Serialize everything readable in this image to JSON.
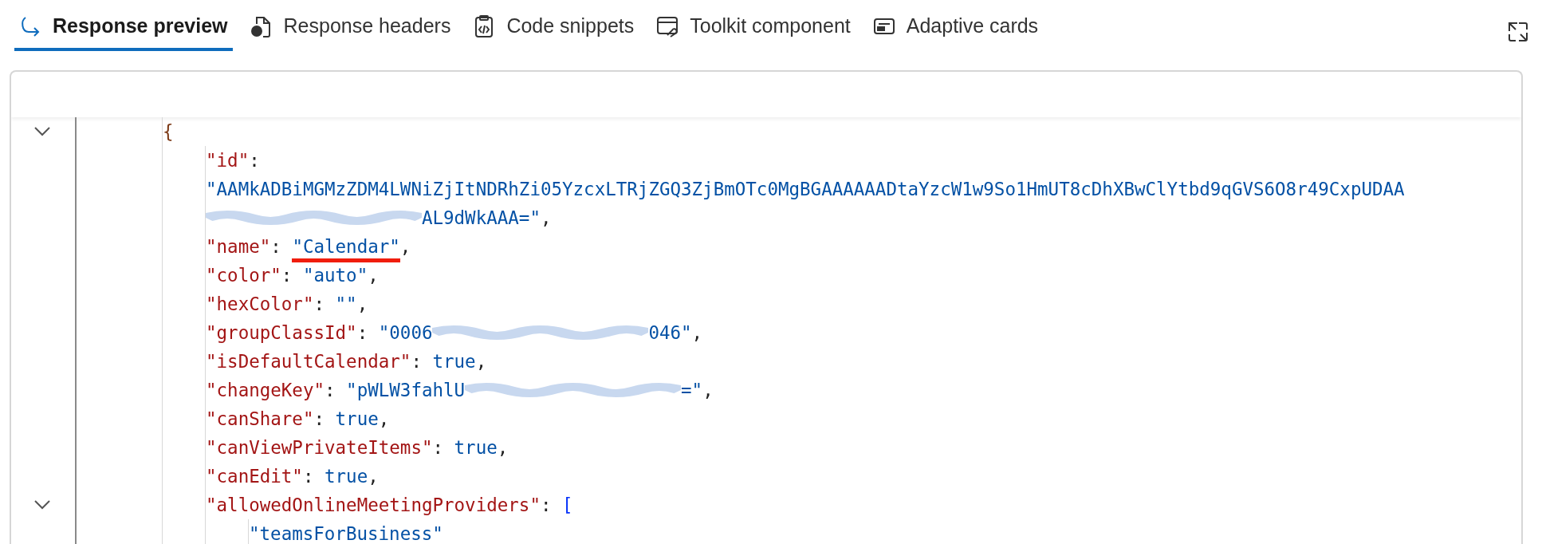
{
  "tabs": [
    {
      "label": "Response preview",
      "selected": true
    },
    {
      "label": "Response headers",
      "selected": false
    },
    {
      "label": "Code snippets",
      "selected": false
    },
    {
      "label": "Toolkit component",
      "selected": false
    },
    {
      "label": "Adaptive cards",
      "selected": false
    }
  ],
  "code": {
    "lines": [
      {
        "fold": true,
        "tokens": [
          {
            "kind": "brace",
            "text": "{"
          }
        ],
        "children": [
          {
            "tokens": [
              {
                "kind": "key",
                "text": "\"id\""
              },
              {
                "kind": "punct",
                "text": ":"
              }
            ]
          },
          {
            "tokens": [
              {
                "kind": "string",
                "text": "\"AAMkADBiMGMzZDM4LWNiZjItNDRhZi05YzcxLTRjZGQ3ZjBmOTc0MgBGAAAAAADtaYzcW1w9So1HmUT8cDhXBwClYtbd9qGVS6O8r49CxpUDAA"
              }
            ]
          },
          {
            "tokens": [
              {
                "kind": "redacted"
              },
              {
                "kind": "string",
                "text": "AL9dWkAAA=\""
              },
              {
                "kind": "punct",
                "text": ","
              }
            ]
          },
          {
            "tokens": [
              {
                "kind": "key",
                "text": "\"name\""
              },
              {
                "kind": "punct",
                "text": ": "
              },
              {
                "kind": "string",
                "text": "\"Calendar\"",
                "underlined": true
              },
              {
                "kind": "punct",
                "text": ","
              }
            ]
          },
          {
            "tokens": [
              {
                "kind": "key",
                "text": "\"color\""
              },
              {
                "kind": "punct",
                "text": ": "
              },
              {
                "kind": "string",
                "text": "\"auto\""
              },
              {
                "kind": "punct",
                "text": ","
              }
            ]
          },
          {
            "tokens": [
              {
                "kind": "key",
                "text": "\"hexColor\""
              },
              {
                "kind": "punct",
                "text": ": "
              },
              {
                "kind": "string",
                "text": "\"\""
              },
              {
                "kind": "punct",
                "text": ","
              }
            ]
          },
          {
            "tokens": [
              {
                "kind": "key",
                "text": "\"groupClassId\""
              },
              {
                "kind": "punct",
                "text": ": "
              },
              {
                "kind": "string",
                "text": "\"0006"
              },
              {
                "kind": "redacted"
              },
              {
                "kind": "string",
                "text": "046\""
              },
              {
                "kind": "punct",
                "text": ","
              }
            ]
          },
          {
            "tokens": [
              {
                "kind": "key",
                "text": "\"isDefaultCalendar\""
              },
              {
                "kind": "punct",
                "text": ": "
              },
              {
                "kind": "keyword",
                "text": "true"
              },
              {
                "kind": "punct",
                "text": ","
              }
            ]
          },
          {
            "tokens": [
              {
                "kind": "key",
                "text": "\"changeKey\""
              },
              {
                "kind": "punct",
                "text": ": "
              },
              {
                "kind": "string",
                "text": "\"pWLW3fahlU"
              },
              {
                "kind": "redacted"
              },
              {
                "kind": "string",
                "text": "=\""
              },
              {
                "kind": "punct",
                "text": ","
              }
            ]
          },
          {
            "tokens": [
              {
                "kind": "key",
                "text": "\"canShare\""
              },
              {
                "kind": "punct",
                "text": ": "
              },
              {
                "kind": "keyword",
                "text": "true"
              },
              {
                "kind": "punct",
                "text": ","
              }
            ]
          },
          {
            "tokens": [
              {
                "kind": "key",
                "text": "\"canViewPrivateItems\""
              },
              {
                "kind": "punct",
                "text": ": "
              },
              {
                "kind": "keyword",
                "text": "true"
              },
              {
                "kind": "punct",
                "text": ","
              }
            ]
          },
          {
            "tokens": [
              {
                "kind": "key",
                "text": "\"canEdit\""
              },
              {
                "kind": "punct",
                "text": ": "
              },
              {
                "kind": "keyword",
                "text": "true"
              },
              {
                "kind": "punct",
                "text": ","
              }
            ]
          },
          {
            "fold": true,
            "tokens": [
              {
                "kind": "key",
                "text": "\"allowedOnlineMeetingProviders\""
              },
              {
                "kind": "punct",
                "text": ": "
              },
              {
                "kind": "bracket",
                "text": "["
              }
            ],
            "children": [
              {
                "tokens": [
                  {
                    "kind": "string",
                    "text": "\"teamsForBusiness\""
                  }
                ]
              }
            ]
          }
        ]
      }
    ]
  }
}
